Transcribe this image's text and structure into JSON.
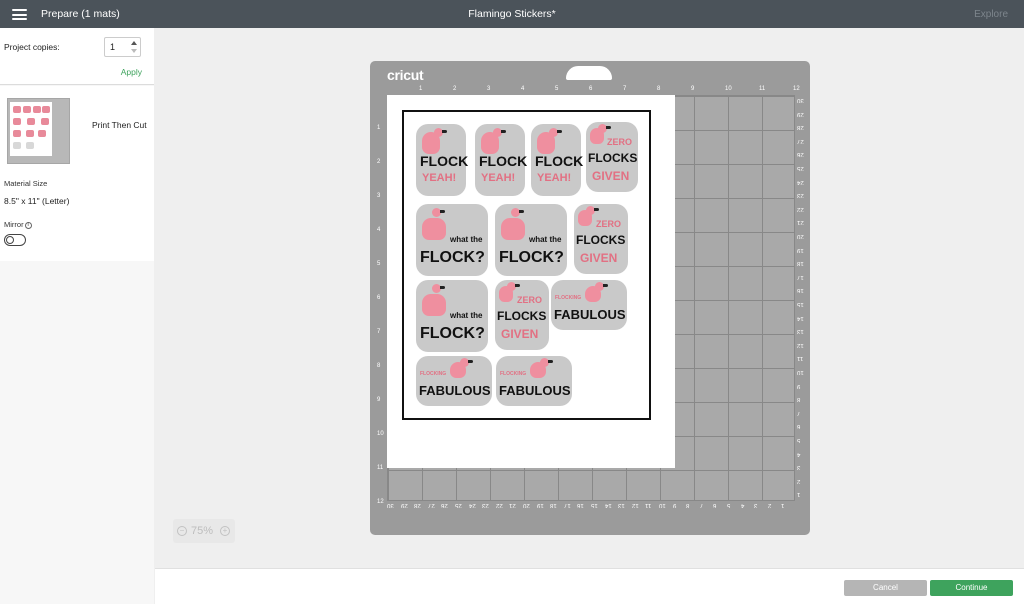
{
  "header": {
    "prepare_title": "Prepare (1 mats)",
    "project_title": "Flamingo Stickers*",
    "explore_label": "Explore"
  },
  "left_panel": {
    "copies_label": "Project copies:",
    "copies_value": "1",
    "apply_label": "Apply",
    "mat_mode": "Print Then Cut",
    "material_size_label": "Material Size",
    "material_size_value": "8.5\" x 11\" (Letter)",
    "mirror_label": "Mirror",
    "mirror_info": "i"
  },
  "mat": {
    "brand": "cricut",
    "ruler_top": [
      "1",
      "2",
      "3",
      "4",
      "5",
      "6",
      "7",
      "8",
      "9",
      "10",
      "11",
      "12"
    ],
    "ruler_left": [
      "1",
      "2",
      "3",
      "4",
      "5",
      "6",
      "7",
      "8",
      "9",
      "10",
      "11",
      "12"
    ],
    "ruler_right": [
      "30",
      "29",
      "28",
      "27",
      "26",
      "25",
      "24",
      "23",
      "22",
      "21",
      "20",
      "19",
      "18",
      "17",
      "16",
      "15",
      "14",
      "13",
      "12",
      "11",
      "10",
      "9",
      "8",
      "7",
      "6",
      "5",
      "4",
      "3",
      "2",
      "1"
    ],
    "ruler_bottom": [
      "30",
      "29",
      "28",
      "27",
      "26",
      "25",
      "24",
      "23",
      "22",
      "21",
      "20",
      "19",
      "18",
      "17",
      "16",
      "15",
      "14",
      "13",
      "12",
      "11",
      "10",
      "9",
      "8",
      "7",
      "6",
      "5",
      "4",
      "3",
      "2",
      "1"
    ]
  },
  "stickers": {
    "flock": "FLOCK",
    "yeah": "YEAH!",
    "zero": "ZERO",
    "flocks": "FLOCKS",
    "given": "GIVEN",
    "what_the": "what the",
    "flock_q": "FLOCK?",
    "flocking": "FLOCKING",
    "fabulous": "FABULOUS"
  },
  "zoom": {
    "minus": "−",
    "value": "75%",
    "plus": "+"
  },
  "footer": {
    "cancel_label": "Cancel",
    "continue_label": "Continue"
  },
  "colors": {
    "topbar": "#4b535a",
    "accent_green": "#3ea35d",
    "mat_gray": "#9b9b9b",
    "flamingo_pink": "#ef8f9f"
  }
}
